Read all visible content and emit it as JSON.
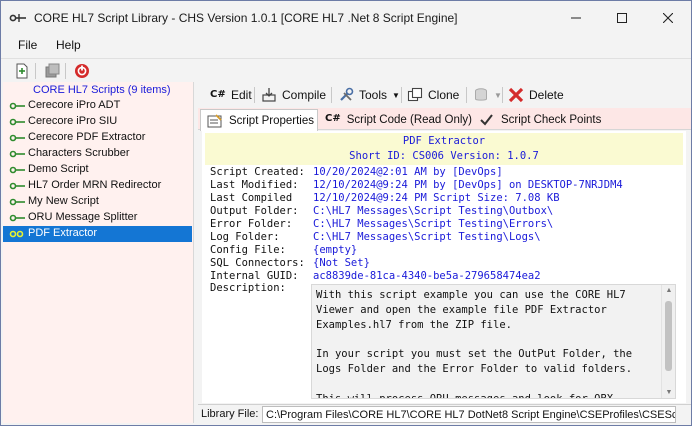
{
  "window": {
    "title": "CORE HL7 Script Library - CHS Version 1.0.1 [CORE HL7 .Net 8 Script Engine]",
    "minimize_icon": "minimize-icon",
    "maximize_icon": "maximize-icon",
    "close_icon": "close-icon"
  },
  "menu": {
    "items": [
      {
        "label": "File"
      },
      {
        "label": "Help"
      }
    ]
  },
  "main_toolbar": {
    "icons": [
      "new-script-icon",
      "library-icon",
      "stop-icon"
    ]
  },
  "tree": {
    "root_label": "CORE HL7 Scripts (9 items)",
    "items": [
      {
        "label": "Cerecore iPro ADT"
      },
      {
        "label": "Cerecore iPro SIU"
      },
      {
        "label": "Cerecore PDF Extractor"
      },
      {
        "label": "Characters Scrubber"
      },
      {
        "label": "Demo Script"
      },
      {
        "label": "HL7 Order MRN Redirector"
      },
      {
        "label": "My New Script"
      },
      {
        "label": "ORU Message Splitter"
      },
      {
        "label": "PDF Extractor",
        "selected": true
      }
    ]
  },
  "script_toolbar": {
    "edit_label": "Edit",
    "compile_label": "Compile",
    "tools_label": "Tools",
    "clone_label": "Clone",
    "delete_label": "Delete"
  },
  "tabs": [
    {
      "label": "Script Properties",
      "active": true,
      "icon": "properties-icon"
    },
    {
      "label": "Script Code (Read Only)",
      "icon": "csharp-icon"
    },
    {
      "label": "Script Check Points",
      "icon": "checkpoint-icon"
    }
  ],
  "properties": {
    "script_name": "PDF Extractor",
    "short_id_line": "Short ID: CS006  Version: 1.0.7",
    "rows": [
      {
        "key": "Script Created:",
        "value": "10/20/2024@2:01 AM by [DevOps]"
      },
      {
        "key": "Last Modified:",
        "value": "12/10/2024@9:24 PM by [DevOps] on DESKTOP-7NRJDM4"
      },
      {
        "key": "Last Compiled",
        "value": "12/10/2024@9:24 PM Script Size: 7.08 KB"
      },
      {
        "key": "Output Folder:",
        "value": "C:\\HL7 Messages\\Script Testing\\Outbox\\"
      },
      {
        "key": "Error Folder:",
        "value": "C:\\HL7 Messages\\Script Testing\\Errors\\"
      },
      {
        "key": "Log Folder:",
        "value": "C:\\HL7 Messages\\Script Testing\\Logs\\"
      },
      {
        "key": "Config File:",
        "value": "{empty}"
      },
      {
        "key": "SQL Connectors:",
        "value": "{Not Set}"
      },
      {
        "key": "Internal GUID:",
        "value": "ac8839de-81ca-4340-be5a-279658474ea2"
      }
    ],
    "description_label": "Description:",
    "description": "With this script example you can use the CORE HL7 Viewer and open the example file PDF Extractor Examples.hl7 from the ZIP file.\n\nIn your script you must set the OutPut Folder, the Logs Folder and the Error Folder to valid folders.\n\nThis will process ORU messages and look for OBX segments"
  },
  "library_file": {
    "label": "Library File:",
    "value": "C:\\Program Files\\CORE HL7\\CORE HL7 DotNet8 Script Engine\\CSEProfiles\\CSEScr"
  },
  "colors": {
    "accent_blue": "#1a1ad9",
    "selection": "#1476d4",
    "left_panel_bg": "#fff1ef",
    "tab_strip_bg": "#fde7e6",
    "header_bg": "#fafad2",
    "node_green": "#2e8b2e",
    "delete_red": "#d42a2a"
  }
}
